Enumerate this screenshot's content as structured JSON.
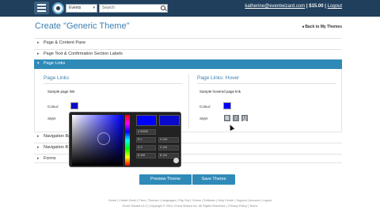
{
  "header": {
    "scope_value": "Events",
    "search_placeholder": "Search",
    "user_email": "katherine@eventwizard.com",
    "separator1": "|",
    "balance": "$15.00",
    "separator2": "|",
    "logout": "Logout"
  },
  "page": {
    "title": "Create \"Generic Theme\"",
    "back_link": "Back to My Themes"
  },
  "sections": [
    {
      "label": "Page & Content Pane",
      "expanded": false
    },
    {
      "label": "Page Text & Confirmation Section Labels",
      "expanded": false
    },
    {
      "label": "Page Links",
      "expanded": true
    },
    {
      "label": "Navigation Bar",
      "expanded": false
    },
    {
      "label": "Navigation B",
      "expanded": false
    },
    {
      "label": "Forms",
      "expanded": false
    }
  ],
  "page_links": {
    "left": {
      "title": "Page Links",
      "sample": "Sample page link",
      "colour_label": "Colour:",
      "style_label": "Style:",
      "colour": "#0a0acc"
    },
    "right": {
      "title": "Page Links: Hover",
      "sample": "Sample hovered page link",
      "colour_label": "Colour:",
      "style_label": "Style:",
      "colour": "#0000ff",
      "styles": [
        "B",
        "I",
        "U"
      ]
    }
  },
  "color_picker": {
    "new_color": "#0000ff",
    "current_color": "#0a0acc",
    "fields": [
      {
        "label": "R",
        "value": "0"
      },
      {
        "label": "G",
        "value": "0"
      },
      {
        "label": "B",
        "value": "255"
      },
      {
        "label": "H",
        "value": "240"
      },
      {
        "label": "S",
        "value": "100"
      },
      {
        "label": "B",
        "value": "100"
      },
      {
        "label": "#",
        "value": "0000ff"
      }
    ]
  },
  "actions": {
    "preview": "Preview Theme",
    "save": "Save Theme"
  },
  "footer": {
    "links": "Home | Create Event | Fees | Themes | Languages | Pay Out | Orders | Software | Help Centre | Support | Account | Logout",
    "copyright": "Event Wizard v2.0 | Copyright © 2014, Event Wizard Inc. All Rights Reserved. | Privacy Policy | Terms"
  },
  "colors": {
    "topbar": "#1f3f5c",
    "accent": "#2f8ab8",
    "title": "#3d7fb0"
  }
}
